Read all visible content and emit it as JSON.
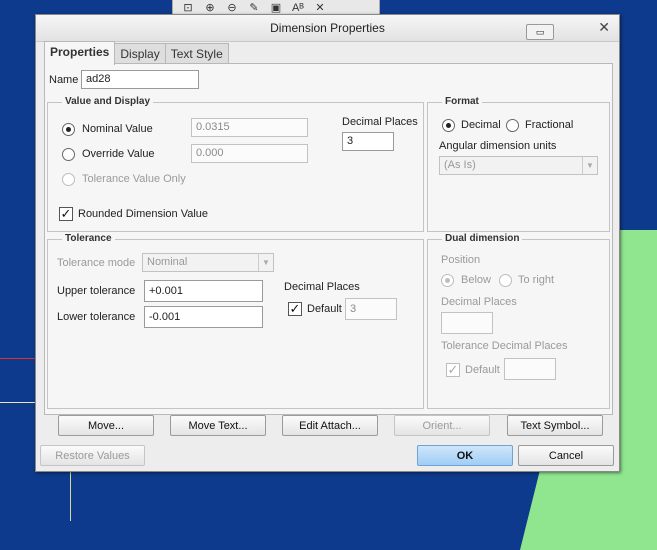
{
  "dialog": {
    "title": "Dimension Properties",
    "close_glyph": "✕",
    "tabs": [
      "Properties",
      "Display",
      "Text Style"
    ],
    "name_label": "Name",
    "name_value": "ad28"
  },
  "value_display": {
    "title": "Value and Display",
    "nominal_label": "Nominal Value",
    "nominal_value": "0.0315",
    "override_label": "Override Value",
    "override_value": "0.000",
    "tol_only_label": "Tolerance Value Only",
    "decimal_label": "Decimal Places",
    "decimal_value": "3",
    "rounded_label": "Rounded Dimension Value",
    "rounded_checked": true
  },
  "format": {
    "title": "Format",
    "decimal_label": "Decimal",
    "fractional_label": "Fractional",
    "angular_label": "Angular dimension units",
    "angular_value": "(As Is)"
  },
  "tolerance": {
    "title": "Tolerance",
    "mode_label": "Tolerance mode",
    "mode_value": "Nominal",
    "upper_label": "Upper tolerance",
    "upper_value": "+0.001",
    "lower_label": "Lower tolerance",
    "lower_value": "-0.001",
    "decimal_label": "Decimal Places",
    "default_label": "Default",
    "default_value": "3"
  },
  "dual": {
    "title": "Dual dimension",
    "position_label": "Position",
    "below_label": "Below",
    "right_label": "To right",
    "decimal_label": "Decimal Places",
    "decimal_value": "",
    "tol_decimal_label": "Tolerance Decimal Places",
    "default_label": "Default",
    "default_value": ""
  },
  "buttons": {
    "move": "Move...",
    "move_text": "Move Text...",
    "edit_attach": "Edit Attach...",
    "orient": "Orient...",
    "text_symbol": "Text Symbol...",
    "restore": "Restore Values",
    "ok": "OK",
    "cancel": "Cancel"
  },
  "toolbar": {
    "icons": [
      "zoom-window-icon",
      "zoom-in-icon",
      "zoom-out-icon",
      "edit-icon",
      "box-icon",
      "text-icon",
      "spline-icon"
    ]
  }
}
